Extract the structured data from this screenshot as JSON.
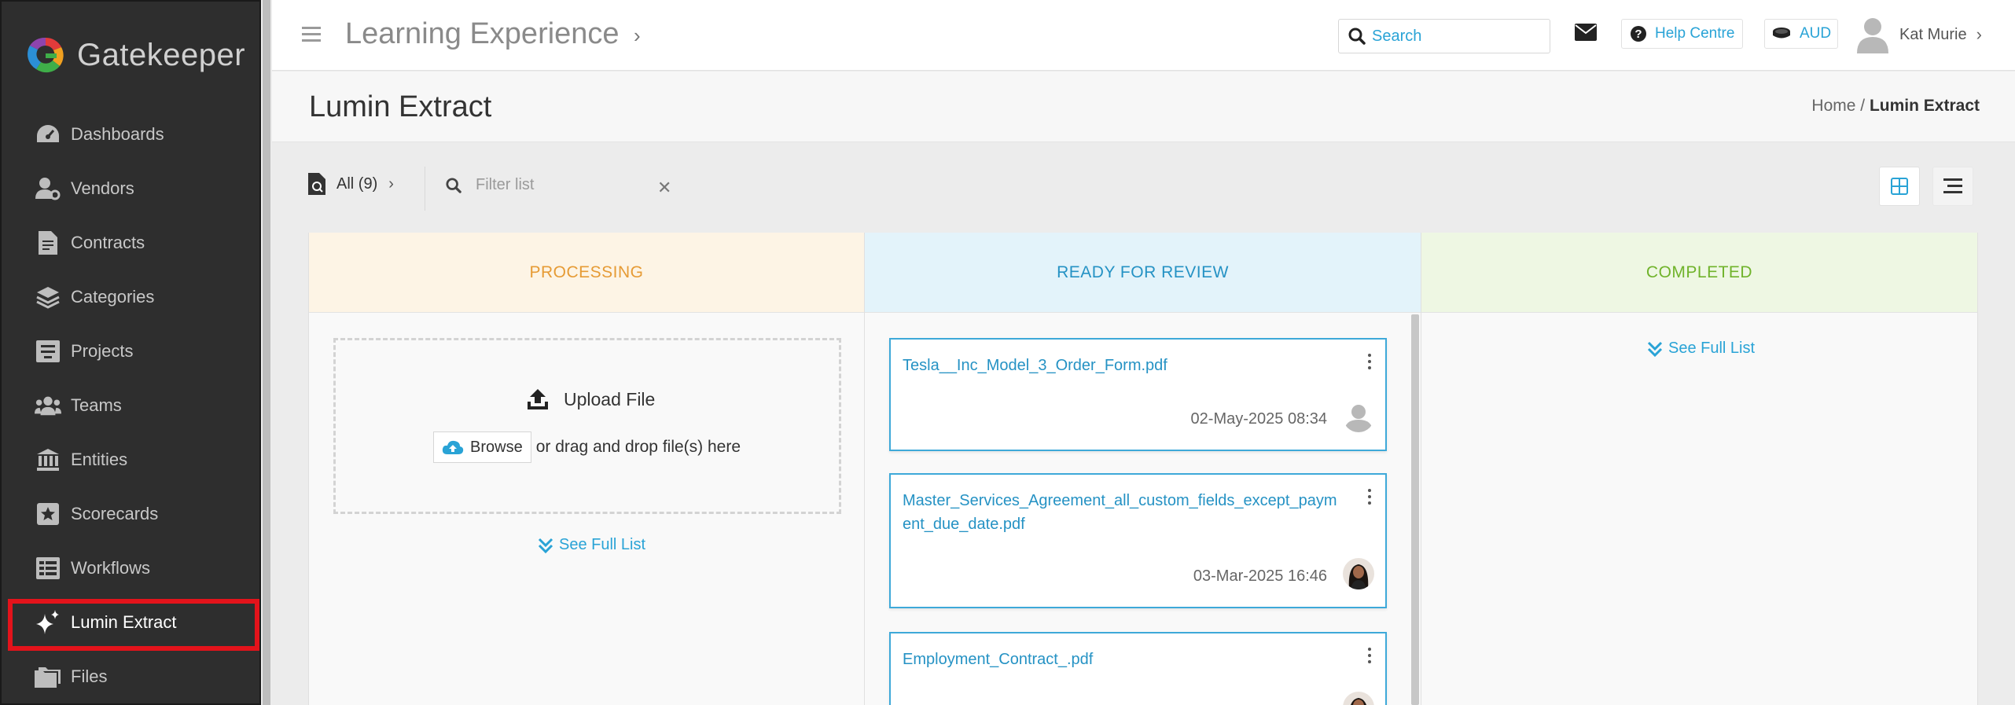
{
  "brand": {
    "name": "Gatekeeper"
  },
  "sidebar": {
    "items": [
      {
        "label": "Dashboards",
        "icon": "dashboard-gauge-icon"
      },
      {
        "label": "Vendors",
        "icon": "vendor-user-icon"
      },
      {
        "label": "Contracts",
        "icon": "contract-document-icon"
      },
      {
        "label": "Categories",
        "icon": "layers-icon"
      },
      {
        "label": "Projects",
        "icon": "projects-box-icon"
      },
      {
        "label": "Teams",
        "icon": "team-users-icon"
      },
      {
        "label": "Entities",
        "icon": "bank-building-icon"
      },
      {
        "label": "Scorecards",
        "icon": "star-card-icon"
      },
      {
        "label": "Workflows",
        "icon": "workflow-grid-icon"
      },
      {
        "label": "Lumin Extract",
        "icon": "sparkle-icon",
        "active": true
      },
      {
        "label": "Files",
        "icon": "folders-icon"
      }
    ]
  },
  "topbar": {
    "app_title": "Learning Experience",
    "search_placeholder": "Search",
    "help_label": "Help Centre",
    "currency_label": "AUD",
    "user_name": "Kat Murie"
  },
  "page": {
    "title": "Lumin Extract",
    "breadcrumb": {
      "home": "Home",
      "separator": "/",
      "current": "Lumin Extract"
    }
  },
  "filter": {
    "all_label": "All (9)",
    "placeholder": "Filter list"
  },
  "board": {
    "processing": {
      "title": "PROCESSING",
      "upload_label": "Upload File",
      "browse_label": "Browse",
      "drop_text": "or drag and drop file(s) here",
      "see_full": "See Full List"
    },
    "review": {
      "title": "READY FOR REVIEW",
      "cards": [
        {
          "filename": "Tesla__Inc_Model_3_Order_Form.pdf",
          "date": "02-May-2025 08:34"
        },
        {
          "filename": "Master_Services_Agreement_all_custom_fields_except_payment_due_date.pdf",
          "date": "03-Mar-2025 16:46"
        },
        {
          "filename": "Employment_Contract_.pdf",
          "date": ""
        }
      ]
    },
    "completed": {
      "title": "COMPLETED",
      "see_full": "See Full List"
    }
  },
  "colors": {
    "sidebar_bg": "#2e2e2e",
    "accent_blue": "#29a3d6",
    "processing": "#e69b35",
    "review": "#2592c4",
    "completed": "#70b32b",
    "active_highlight": "#e3131b"
  }
}
